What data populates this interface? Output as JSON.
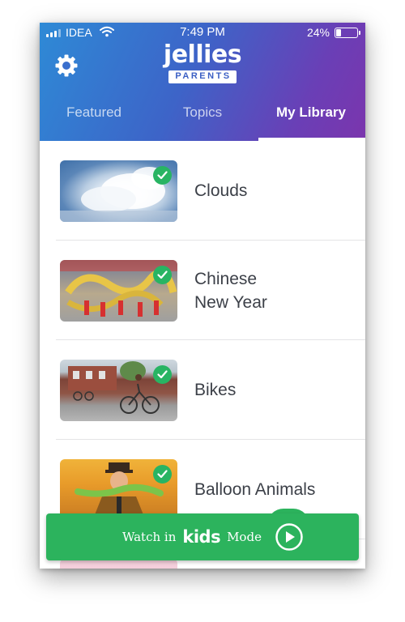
{
  "status_bar": {
    "carrier": "IDEA",
    "time": "7:49 PM",
    "battery_percent": "24%",
    "battery_level": 0.24,
    "icons": [
      "signal-icon",
      "wifi-icon",
      "battery-icon"
    ]
  },
  "header": {
    "logo_word": "jellies",
    "logo_badge": "PARENTS",
    "settings_icon": "gear-icon",
    "gradient_colors": [
      "#2e8ad6",
      "#7b35ad"
    ]
  },
  "tabs": [
    {
      "label": "Featured",
      "active": false
    },
    {
      "label": "Topics",
      "active": false
    },
    {
      "label": "My Library",
      "active": true
    }
  ],
  "library": [
    {
      "title": "Clouds",
      "checked": true
    },
    {
      "title": "Chinese\nNew Year",
      "checked": true
    },
    {
      "title": "Bikes",
      "checked": true
    },
    {
      "title": "Balloon Animals",
      "checked": true
    }
  ],
  "watch_bar": {
    "prefix": "Watch in",
    "brand": "kids",
    "suffix": "Mode",
    "play_icon": "play-circle-icon",
    "color": "#2cb35d"
  },
  "colors": {
    "checkmark": "#28b463",
    "title_text": "#3c4048"
  }
}
